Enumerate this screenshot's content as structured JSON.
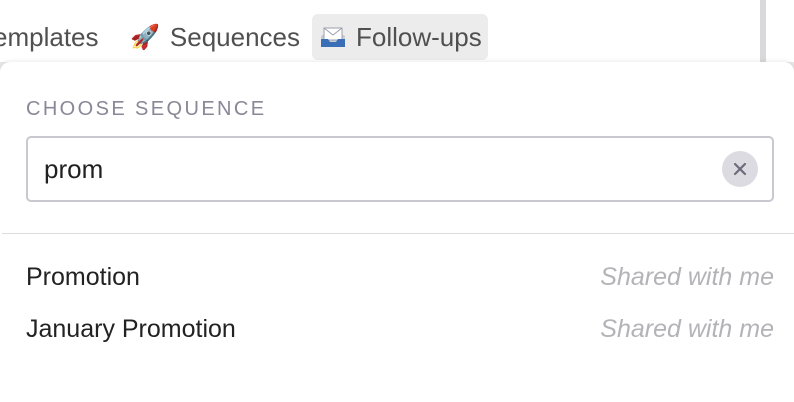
{
  "tabs": [
    {
      "label": "Templates",
      "icon": "templates-icon"
    },
    {
      "label": "Sequences",
      "icon": "rocket-icon",
      "emoji": "🚀"
    },
    {
      "label": "Follow-ups",
      "icon": "inbox-tray-icon",
      "emoji": "📨",
      "active": true
    }
  ],
  "dropdown": {
    "heading": "CHOOSE SEQUENCE",
    "search_value": "prom",
    "clear_icon": "close-icon",
    "results": [
      {
        "name": "Promotion",
        "meta": "Shared with me"
      },
      {
        "name": "January Promotion",
        "meta": "Shared with me"
      }
    ]
  },
  "colors": {
    "heading": "#8a8797",
    "result_text": "#222222",
    "meta_text": "#b3b3b8",
    "active_tab_bg": "#ececed"
  }
}
